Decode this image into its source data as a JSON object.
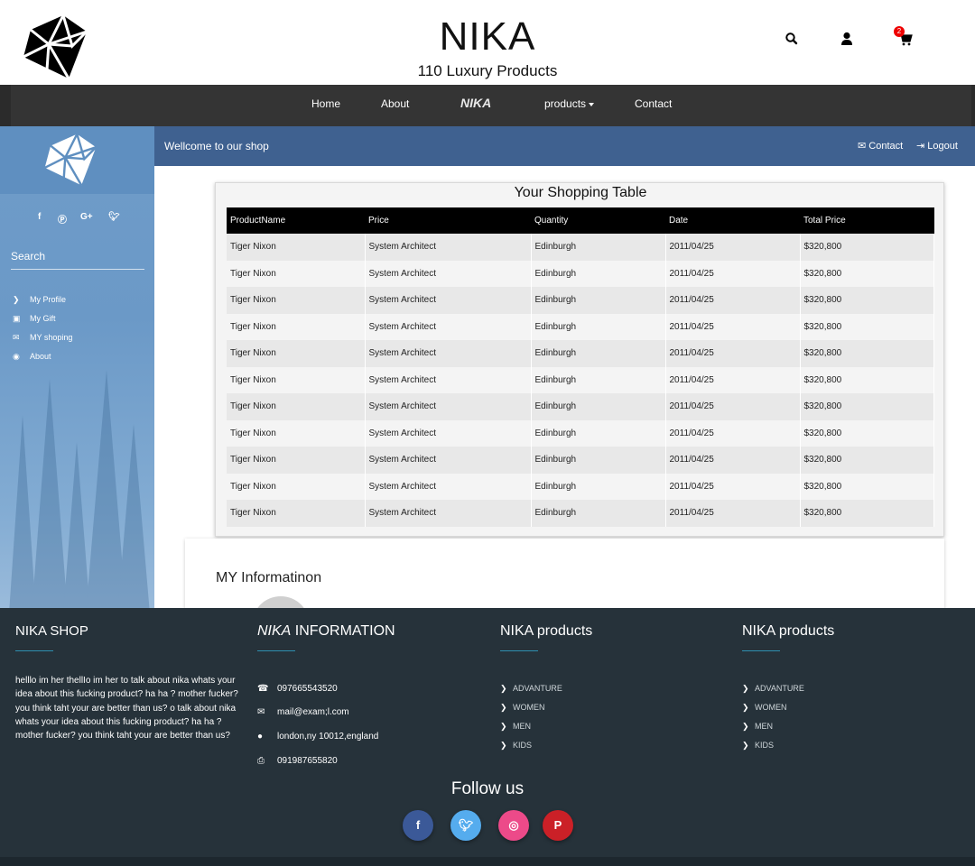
{
  "header": {
    "title": "NIKA",
    "subtitle": "110 Luxury Products",
    "cart_count": "2",
    "icons": [
      "search-icon",
      "user-icon",
      "cart-icon"
    ]
  },
  "nav": {
    "home": "Home",
    "about": "About",
    "brand": "NIKA",
    "products": "products",
    "contact": "Contact"
  },
  "sidebar": {
    "social_icons": [
      "facebook-icon",
      "pinterest-icon",
      "google-plus-icon",
      "twitter-icon"
    ],
    "search_placeholder": "Search",
    "menu": [
      {
        "label": "My Profile",
        "icon": "chevron-right-icon"
      },
      {
        "label": "My Gift",
        "icon": "gift-icon"
      },
      {
        "label": "MY shoping",
        "icon": "envelope-icon"
      },
      {
        "label": "About",
        "icon": "eye-icon"
      }
    ]
  },
  "welcome": {
    "message": "Wellcome to our shop",
    "contact": "Contact",
    "logout": "Logout"
  },
  "shopping_table": {
    "title": "Your Shopping Table",
    "columns": [
      "ProductName",
      "Price",
      "Quantity",
      "Date",
      "Total Price"
    ],
    "rows": [
      [
        "Tiger Nixon",
        "System Architect",
        "Edinburgh",
        "2011/04/25",
        "$320,800"
      ],
      [
        "Tiger Nixon",
        "System Architect",
        "Edinburgh",
        "2011/04/25",
        "$320,800"
      ],
      [
        "Tiger Nixon",
        "System Architect",
        "Edinburgh",
        "2011/04/25",
        "$320,800"
      ],
      [
        "Tiger Nixon",
        "System Architect",
        "Edinburgh",
        "2011/04/25",
        "$320,800"
      ],
      [
        "Tiger Nixon",
        "System Architect",
        "Edinburgh",
        "2011/04/25",
        "$320,800"
      ],
      [
        "Tiger Nixon",
        "System Architect",
        "Edinburgh",
        "2011/04/25",
        "$320,800"
      ],
      [
        "Tiger Nixon",
        "System Architect",
        "Edinburgh",
        "2011/04/25",
        "$320,800"
      ],
      [
        "Tiger Nixon",
        "System Architect",
        "Edinburgh",
        "2011/04/25",
        "$320,800"
      ],
      [
        "Tiger Nixon",
        "System Architect",
        "Edinburgh",
        "2011/04/25",
        "$320,800"
      ],
      [
        "Tiger Nixon",
        "System Architect",
        "Edinburgh",
        "2011/04/25",
        "$320,800"
      ],
      [
        "Tiger Nixon",
        "System Architect",
        "Edinburgh",
        "2011/04/25",
        "$320,800"
      ]
    ]
  },
  "info_section": {
    "title": "MY Informatinon"
  },
  "footer": {
    "col1_title": "NIKA SHOP",
    "about_text": "helllo im her thellIo im her to talk about nika whats your idea about this fucking product? ha ha ? mother fucker? you think taht your are better than us? o talk about nika whats your idea about this fucking product? ha ha ? mother fucker? you think taht your are better than us?",
    "col2_title_brand": "NIKA",
    "col2_title_rest": "INFORMATION",
    "phone": "097665543520",
    "email": "mail@exam;l.com",
    "address": "london,ny 10012,england",
    "fax": "091987655820",
    "col3_title": "NIKA products",
    "col3_items": [
      "ADVANTURE",
      "WOMEN",
      "MEN",
      "KIDS"
    ],
    "col4_title": "NIKA products",
    "col4_items": [
      "ADVANTURE",
      "WOMEN",
      "MEN",
      "KIDS"
    ],
    "follow_title": "Follow us",
    "follow_buttons": [
      {
        "icon": "facebook-icon",
        "color": "#3b5998"
      },
      {
        "icon": "twitter-icon",
        "color": "#55acee"
      },
      {
        "icon": "instagram-icon",
        "color": "#ec4a89"
      },
      {
        "icon": "pinterest-icon",
        "color": "#cb2027"
      }
    ]
  }
}
